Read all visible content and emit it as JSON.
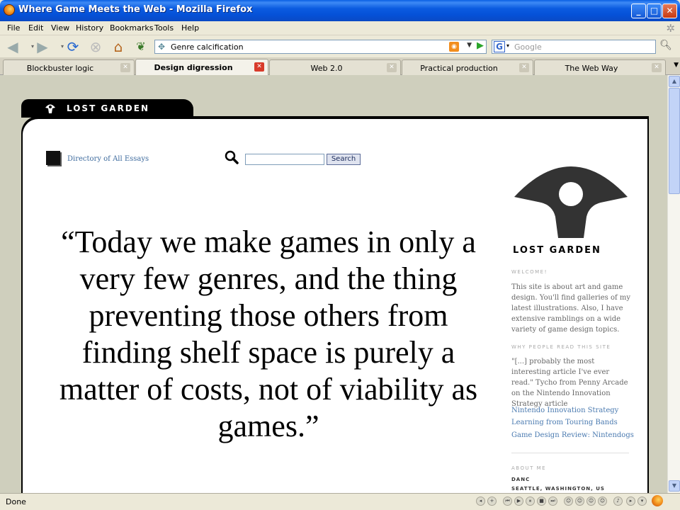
{
  "window": {
    "title": "Where Game Meets the Web - Mozilla Firefox"
  },
  "menu": [
    "File",
    "Edit",
    "View",
    "History",
    "Bookmarks",
    "Tools",
    "Help"
  ],
  "nav": {
    "url": "Genre calcification",
    "search_placeholder": "Google",
    "search_engine_letter": "G"
  },
  "tabs": [
    {
      "label": "Blockbuster logic",
      "active": false
    },
    {
      "label": "Design digression",
      "active": true
    },
    {
      "label": "Web 2.0",
      "active": false
    },
    {
      "label": "Practical production",
      "active": false
    },
    {
      "label": "The Web Way",
      "active": false
    }
  ],
  "page": {
    "brand": "LOST GARDEN",
    "directory_link": "Directory of All Essays",
    "search_button": "Search",
    "quote": "“Today we make games in only a very few genres, and the thing preventing those others from finding shelf space is purely a matter of costs, not of viability as games.”",
    "sidebar": {
      "logo_name": "LOST GARDEN",
      "welcome_heading": "WELCOME!",
      "welcome_text": "This site is about art and game design. You'll find galleries of my latest illustrations. Also, I have extensive ramblings on a wide variety of game design topics.",
      "why_heading": "WHY PEOPLE READ THIS SITE",
      "why_text": "\"[...] probably the most interesting article I've ever read.\" Tycho from Penny Arcade on the Nintendo Innovation Strategy article",
      "links": [
        "Nintendo Innovation Strategy",
        "Learning from Touring Bands",
        "Game Design Review: Nintendogs"
      ],
      "about_heading": "ABOUT ME",
      "about_name": "DANC",
      "about_location": "SEATTLE, WASHINGTON, US"
    }
  },
  "status": {
    "text": "Done"
  }
}
